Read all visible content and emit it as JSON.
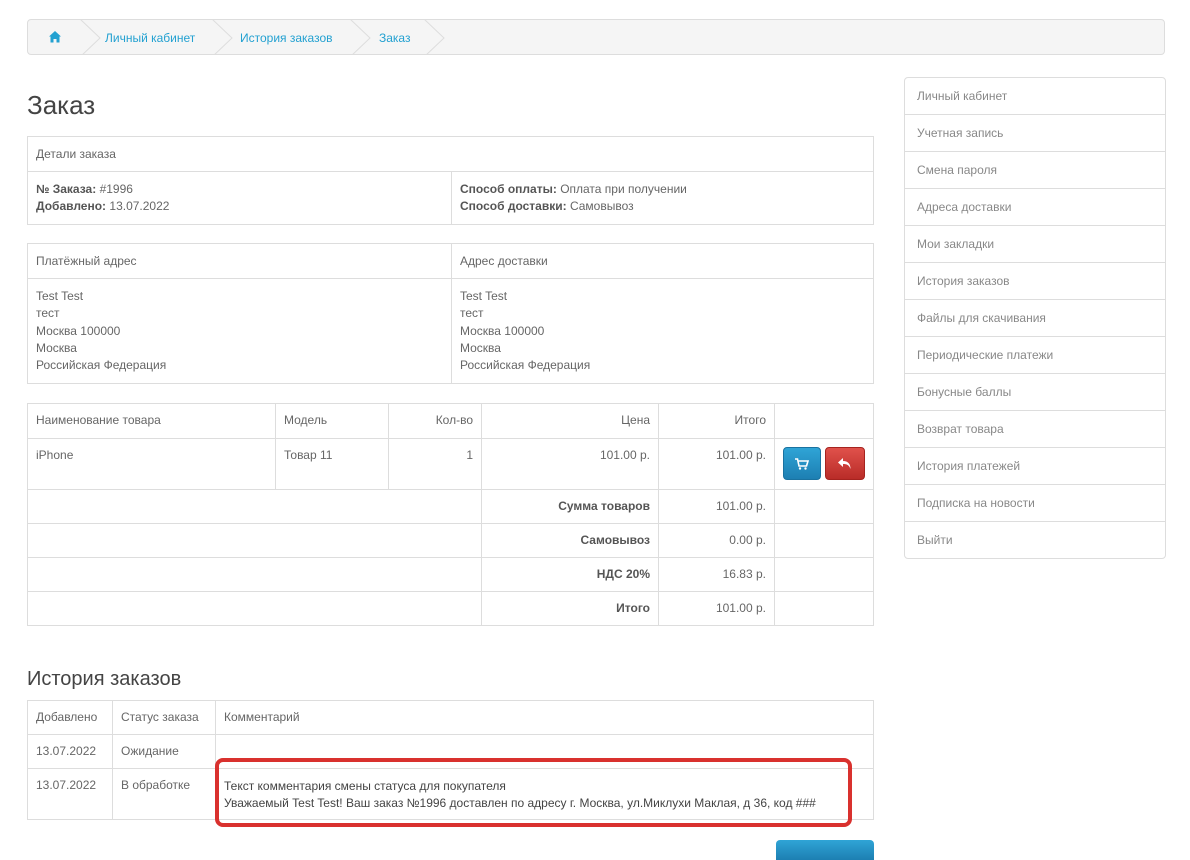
{
  "breadcrumb": {
    "items": [
      "Личный кабинет",
      "История заказов",
      "Заказ"
    ]
  },
  "page_title": "Заказ",
  "order_details": {
    "header": "Детали заказа",
    "order_no_label": "№ Заказа:",
    "order_no": "#1996",
    "added_label": "Добавлено:",
    "added": "13.07.2022",
    "payment_label": "Способ оплаты:",
    "payment": "Оплата при получении",
    "shipping_label": "Способ доставки:",
    "shipping": "Самовывоз"
  },
  "addresses": {
    "payment_header": "Платёжный адрес",
    "shipping_header": "Адрес доставки",
    "payment_lines": [
      "Test Test",
      "тест",
      "Москва 100000",
      "Москва",
      "Российская Федерация"
    ],
    "shipping_lines": [
      "Test Test",
      "тест",
      "Москва 100000",
      "Москва",
      "Российская Федерация"
    ]
  },
  "products": {
    "headers": [
      "Наименование товара",
      "Модель",
      "Кол-во",
      "Цена",
      "Итого"
    ],
    "rows": [
      {
        "name": "iPhone",
        "model": "Товар 11",
        "qty": "1",
        "price": "101.00 р.",
        "total": "101.00 р."
      }
    ],
    "totals": [
      {
        "label": "Сумма товаров",
        "value": "101.00 р."
      },
      {
        "label": "Самовывоз",
        "value": "0.00 р."
      },
      {
        "label": "НДС 20%",
        "value": "16.83 р."
      },
      {
        "label": "Итого",
        "value": "101.00 р."
      }
    ],
    "colors": {
      "reorder": "#2fa4d6",
      "return": "#d9312e"
    }
  },
  "history": {
    "title": "История заказов",
    "headers": [
      "Добавлено",
      "Статус заказа",
      "Комментарий"
    ],
    "rows": [
      {
        "date": "13.07.2022",
        "status": "Ожидание",
        "comment_lines": []
      },
      {
        "date": "13.07.2022",
        "status": "В обработке",
        "comment_lines": [
          "Текст комментария смены статуса для покупателя",
          "Уважаемый Test Test! Ваш заказ №1996 доставлен по адресу г. Москва, ул.Миклухи Маклая, д 36, код ###"
        ]
      }
    ],
    "highlight_color": "#d9312e"
  },
  "sidebar": {
    "items": [
      "Личный кабинет",
      "Учетная запись",
      "Смена пароля",
      "Адреса доставки",
      "Мои закладки",
      "История заказов",
      "Файлы для скачивания",
      "Периодические платежи",
      "Бонусные баллы",
      "Возврат товара",
      "История платежей",
      "Подписка на новости",
      "Выйти"
    ]
  },
  "icons": {
    "home": "home-icon",
    "cart": "cart-icon",
    "return": "reply-icon"
  }
}
